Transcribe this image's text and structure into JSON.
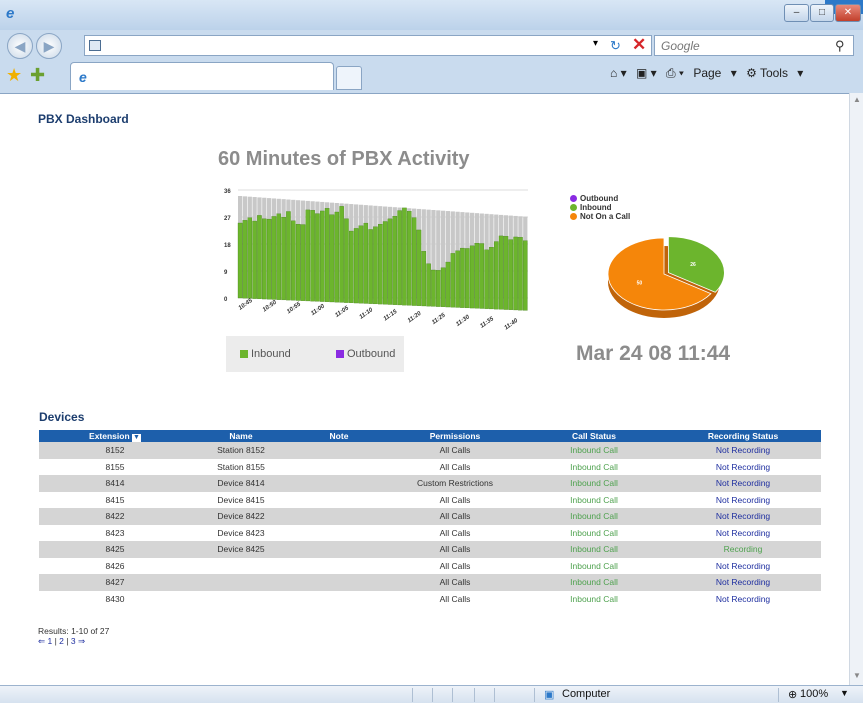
{
  "browser": {
    "search_placeholder": "Google",
    "command_bar": {
      "page_label": "Page",
      "tools_label": "Tools"
    },
    "status_bar": {
      "zone": "Computer",
      "zoom": "100%"
    }
  },
  "page": {
    "title": "PBX Dashboard",
    "chart_title": "60 Minutes of PBX Activity",
    "legend": {
      "inbound": "Inbound",
      "outbound": "Outbound"
    },
    "pie_legend": {
      "outbound": "Outbound",
      "inbound": "Inbound",
      "not_on_call": "Not On a Call"
    },
    "datetime": "Mar 24 08 11:44",
    "devices_title": "Devices",
    "results_text": "Results: 1-10 of 27",
    "pager": {
      "prev": "⇐",
      "p1": "1",
      "p2": "2",
      "p3": "3",
      "next": "⇒"
    }
  },
  "table": {
    "headers": [
      "Extension",
      "Name",
      "Note",
      "Permissions",
      "Call Status",
      "Recording Status"
    ],
    "rows": [
      {
        "ext": "8152",
        "name": "Station 8152",
        "note": "",
        "perm": "All Calls",
        "call": "Inbound Call",
        "rec": "Not Recording"
      },
      {
        "ext": "8155",
        "name": "Station 8155",
        "note": "",
        "perm": "All Calls",
        "call": "Inbound Call",
        "rec": "Not Recording"
      },
      {
        "ext": "8414",
        "name": "Device 8414",
        "note": "",
        "perm": "Custom Restrictions",
        "call": "Inbound Call",
        "rec": "Not Recording"
      },
      {
        "ext": "8415",
        "name": "Device 8415",
        "note": "",
        "perm": "All Calls",
        "call": "Inbound Call",
        "rec": "Not Recording"
      },
      {
        "ext": "8422",
        "name": "Device 8422",
        "note": "",
        "perm": "All Calls",
        "call": "Inbound Call",
        "rec": "Not Recording"
      },
      {
        "ext": "8423",
        "name": "Device 8423",
        "note": "",
        "perm": "All Calls",
        "call": "Inbound Call",
        "rec": "Not Recording"
      },
      {
        "ext": "8425",
        "name": "Device 8425",
        "note": "",
        "perm": "All Calls",
        "call": "Inbound Call",
        "rec": "Recording"
      },
      {
        "ext": "8426",
        "name": "",
        "note": "",
        "perm": "All Calls",
        "call": "Inbound Call",
        "rec": "Not Recording"
      },
      {
        "ext": "8427",
        "name": "",
        "note": "",
        "perm": "All Calls",
        "call": "Inbound Call",
        "rec": "Not Recording"
      },
      {
        "ext": "8430",
        "name": "",
        "note": "",
        "perm": "All Calls",
        "call": "Inbound Call",
        "rec": "Not Recording"
      }
    ]
  },
  "colors": {
    "inbound": "#6cb52d",
    "outbound": "#8a2be2",
    "not_on_call": "#f5860a",
    "capacity": "#c8c8c8",
    "header": "#1d5fab"
  },
  "chart_data": [
    {
      "type": "bar",
      "title": "60 Minutes of PBX Activity",
      "x_ticks": [
        "10:45",
        "10:50",
        "10:55",
        "11:00",
        "11:05",
        "11:10",
        "11:15",
        "11:20",
        "11:25",
        "11:30",
        "11:35",
        "11:40"
      ],
      "y_ticks": [
        0,
        9,
        18,
        27,
        36
      ],
      "ylim": [
        0,
        36
      ],
      "grid": true,
      "legend": "bottom",
      "series": [
        {
          "name": "Inbound",
          "values": [
            25,
            26,
            27,
            26,
            28,
            27,
            27,
            28,
            29,
            28,
            30,
            27,
            26,
            26,
            31,
            31,
            30,
            31,
            32,
            30,
            31,
            33,
            29,
            25,
            26,
            27,
            28,
            26,
            27,
            28,
            29,
            30,
            31,
            33,
            34,
            33,
            31,
            27,
            20,
            16,
            14,
            14,
            15,
            17,
            20,
            21,
            22,
            22,
            23,
            24,
            24,
            22,
            23,
            25,
            27,
            27,
            26,
            27,
            27,
            26
          ]
        },
        {
          "name": "Outbound",
          "values": []
        }
      ],
      "capacity": 34
    },
    {
      "type": "pie",
      "legend": "top-left",
      "slices": [
        {
          "name": "Outbound",
          "value": 0,
          "label": ""
        },
        {
          "name": "Inbound",
          "value": 26,
          "label": "26"
        },
        {
          "name": "Not On a Call",
          "value": 50,
          "label": "50"
        }
      ]
    }
  ]
}
